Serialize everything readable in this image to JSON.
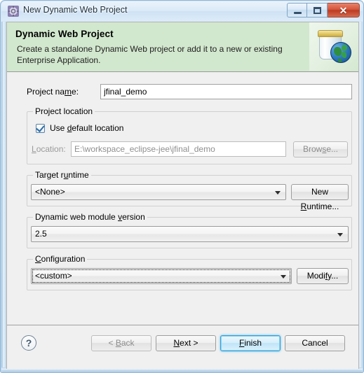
{
  "window": {
    "title": "New Dynamic Web Project",
    "icon": "wizard-gear-icon",
    "minimize_label": "",
    "maximize_label": "",
    "close_label": "✕"
  },
  "banner": {
    "title": "Dynamic Web Project",
    "description": "Create a standalone Dynamic Web project or add it to a new or existing Enterprise Application.",
    "image": "jar-with-globe-icon",
    "background_color": "#d2e8ce"
  },
  "form": {
    "project_name": {
      "label_before": "Project na",
      "label_mnemonic": "m",
      "label_after": "e:",
      "value": "jfinal_demo",
      "placeholder": ""
    },
    "project_location": {
      "group_title": "Project location",
      "use_default": {
        "label_before": "Use ",
        "label_mnemonic": "d",
        "label_after": "efault location",
        "checked": true
      },
      "location": {
        "label_mnemonic": "L",
        "label_after": "ocation:",
        "value": "E:\\workspace_eclipse-jee\\jfinal_demo",
        "enabled": false
      },
      "browse_button": {
        "label_before": "Brow",
        "label_mnemonic": "s",
        "label_after": "e...",
        "enabled": false
      }
    },
    "target_runtime": {
      "group_title_before": "Target r",
      "group_title_mnemonic": "u",
      "group_title_after": "ntime",
      "selected": "<None>",
      "options": [
        "<None>"
      ],
      "new_runtime_button": {
        "label_before": "New ",
        "label_mnemonic": "R",
        "label_after": "untime..."
      }
    },
    "module_version": {
      "group_title_before": "Dynamic web module ",
      "group_title_mnemonic": "v",
      "group_title_after": "ersion",
      "selected": "2.5",
      "options": [
        "2.5"
      ]
    },
    "configuration": {
      "group_title_mnemonic": "C",
      "group_title_after": "onfiguration",
      "selected": "<custom>",
      "options": [
        "<custom>"
      ],
      "focused": true,
      "modify_button": {
        "label_before": "Modi",
        "label_mnemonic": "f",
        "label_after": "y..."
      }
    }
  },
  "buttonbar": {
    "help": "?",
    "back": {
      "label_before": "< ",
      "label_mnemonic": "B",
      "label_after": "ack",
      "enabled": false
    },
    "next": {
      "label_before": "",
      "label_mnemonic": "N",
      "label_after": "ext >",
      "enabled": true
    },
    "finish": {
      "label_before": "",
      "label_mnemonic": "F",
      "label_after": "inish",
      "enabled": true,
      "is_default": true
    },
    "cancel": {
      "label_before": "Cancel",
      "label_mnemonic": "",
      "label_after": "",
      "enabled": true
    }
  }
}
